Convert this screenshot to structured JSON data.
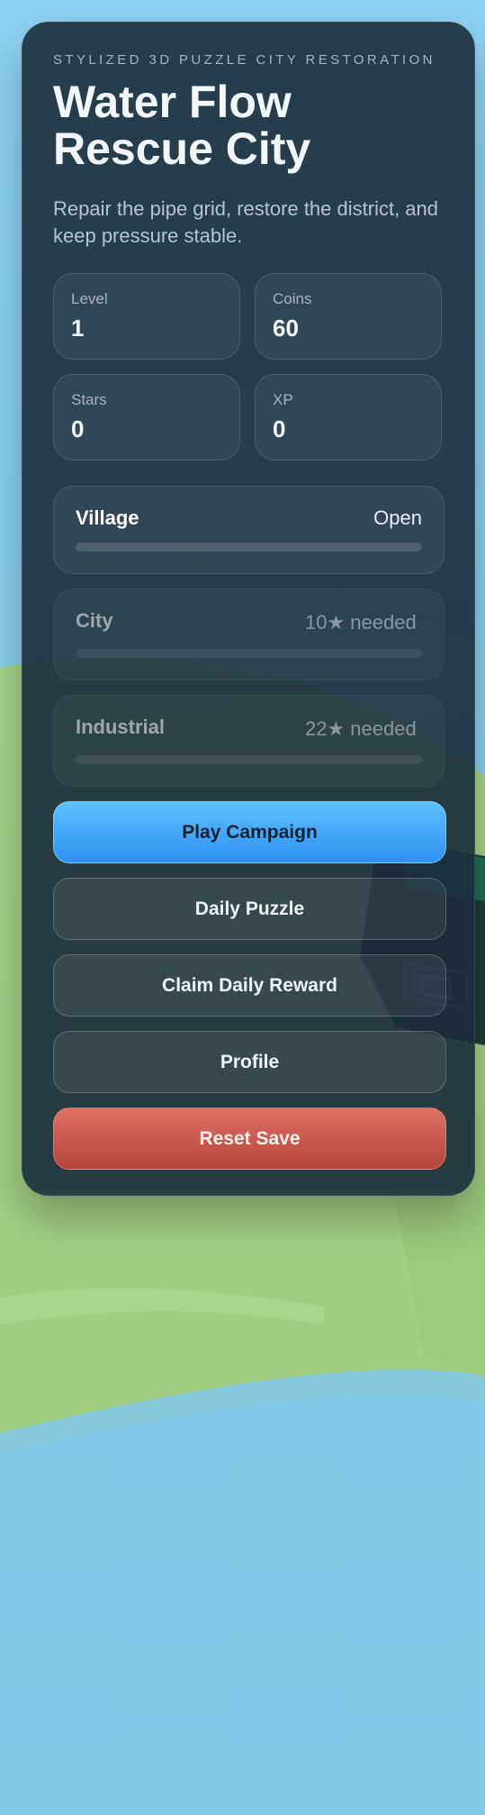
{
  "header": {
    "eyebrow": "STYLIZED 3D PUZZLE CITY RESTORATION",
    "title": "Water Flow Rescue City",
    "subtitle": "Repair the pipe grid, restore the district, and keep pressure stable."
  },
  "stats": [
    {
      "label": "Level",
      "value": "1"
    },
    {
      "label": "Coins",
      "value": "60"
    },
    {
      "label": "Stars",
      "value": "0"
    },
    {
      "label": "XP",
      "value": "0"
    }
  ],
  "districts": [
    {
      "name": "Village",
      "status": "Open",
      "progress": 0,
      "locked": false
    },
    {
      "name": "City",
      "status": "10★ needed",
      "progress": 0,
      "locked": true
    },
    {
      "name": "Industrial",
      "status": "22★ needed",
      "progress": 0,
      "locked": true
    }
  ],
  "buttons": {
    "play": "Play Campaign",
    "daily": "Daily Puzzle",
    "reward": "Claim Daily Reward",
    "profile": "Profile",
    "reset": "Reset Save"
  },
  "colors": {
    "accent": "#4fb8ff",
    "primary_button": "#3a9cf6",
    "danger_button": "#c4554b",
    "panel": "#1b2c3a",
    "grass": "#9fcf84",
    "water": "#7ec8e6",
    "sky": "#8fd0f2"
  }
}
